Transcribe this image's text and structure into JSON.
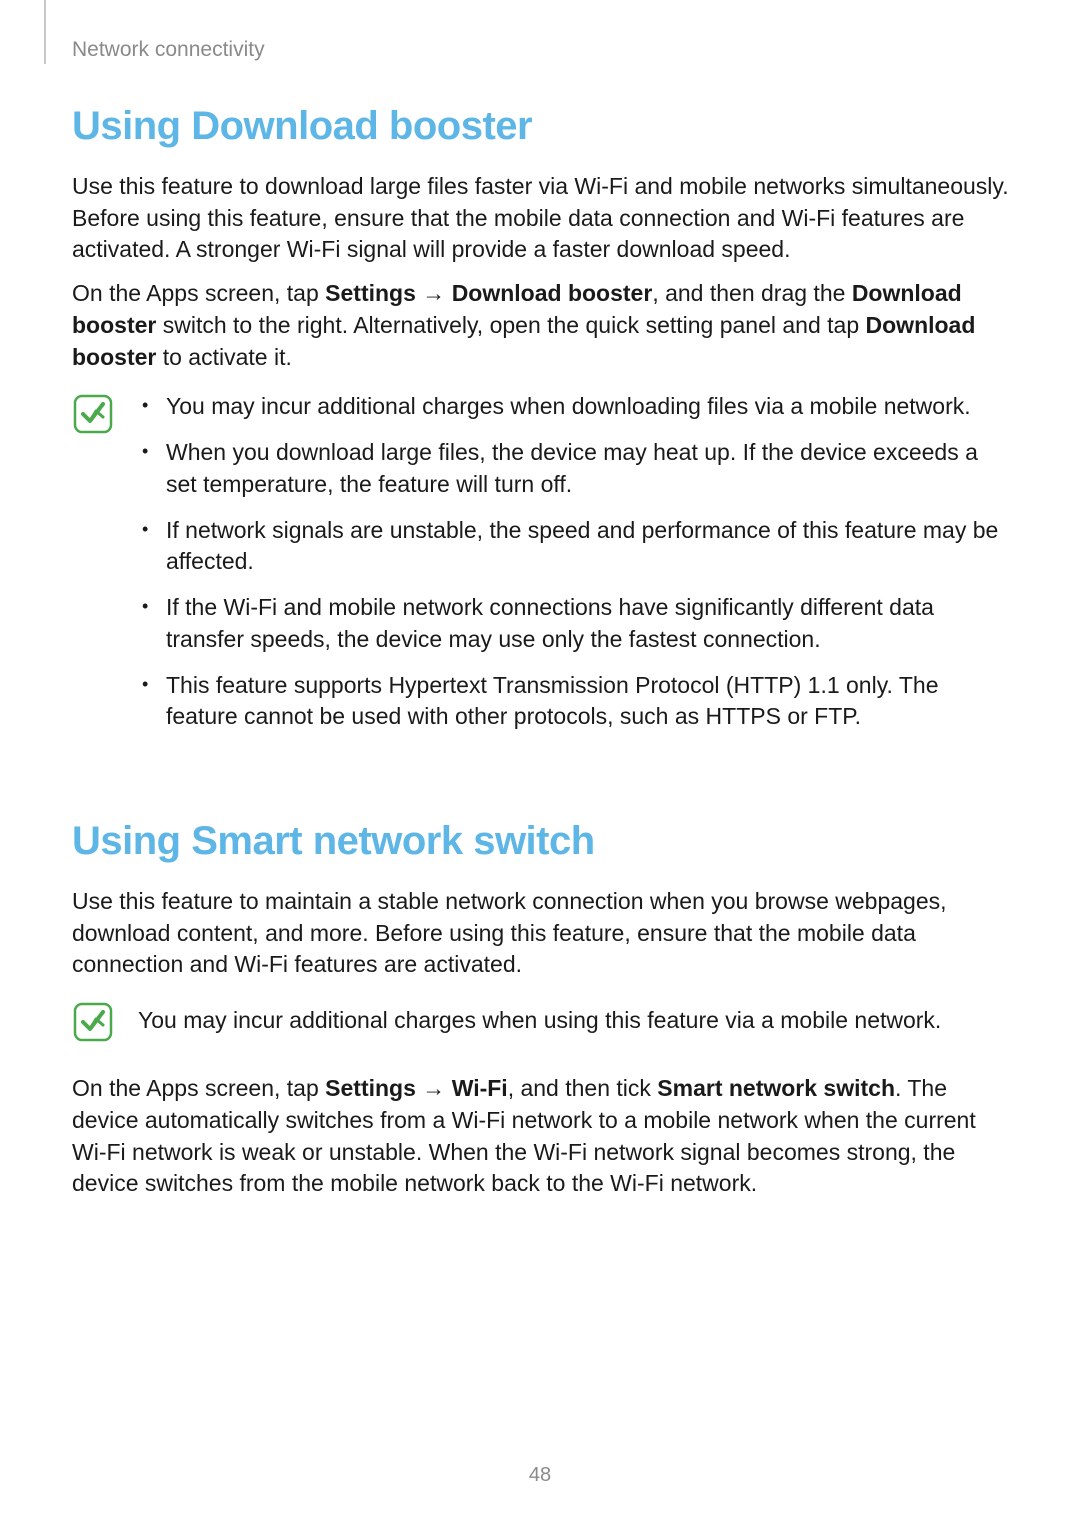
{
  "running_header": "Network connectivity",
  "page_number": "48",
  "section1": {
    "title": "Using Download booster",
    "p1": "Use this feature to download large files faster via Wi-Fi and mobile networks simultaneously. Before using this feature, ensure that the mobile data connection and Wi-Fi features are activated. A stronger Wi-Fi signal will provide a faster download speed.",
    "p2_pre": "On the Apps screen, tap ",
    "p2_settings": "Settings",
    "p2_arrow": " → ",
    "p2_db": "Download booster",
    "p2_mid": ", and then drag the ",
    "p2_db2": "Download booster",
    "p2_mid2": " switch to the right. Alternatively, open the quick setting panel and tap ",
    "p2_db3": "Download booster",
    "p2_end": " to activate it.",
    "notes": [
      "You may incur additional charges when downloading files via a mobile network.",
      "When you download large files, the device may heat up. If the device exceeds a set temperature, the feature will turn off.",
      "If network signals are unstable, the speed and performance of this feature may be affected.",
      "If the Wi-Fi and mobile network connections have significantly different data transfer speeds, the device may use only the fastest connection.",
      "This feature supports Hypertext Transmission Protocol (HTTP) 1.1 only. The feature cannot be used with other protocols, such as HTTPS or FTP."
    ]
  },
  "section2": {
    "title": "Using Smart network switch",
    "p1": "Use this feature to maintain a stable network connection when you browse webpages, download content, and more. Before using this feature, ensure that the mobile data connection and Wi-Fi features are activated.",
    "note": "You may incur additional charges when using this feature via a mobile network.",
    "p2_pre": "On the Apps screen, tap ",
    "p2_settings": "Settings",
    "p2_arrow": " → ",
    "p2_wifi": "Wi-Fi",
    "p2_mid": ", and then tick ",
    "p2_sns": "Smart network switch",
    "p2_end": ". The device automatically switches from a Wi-Fi network to a mobile network when the current Wi-Fi network is weak or unstable. When the Wi-Fi network signal becomes strong, the device switches from the mobile network back to the Wi-Fi network."
  }
}
